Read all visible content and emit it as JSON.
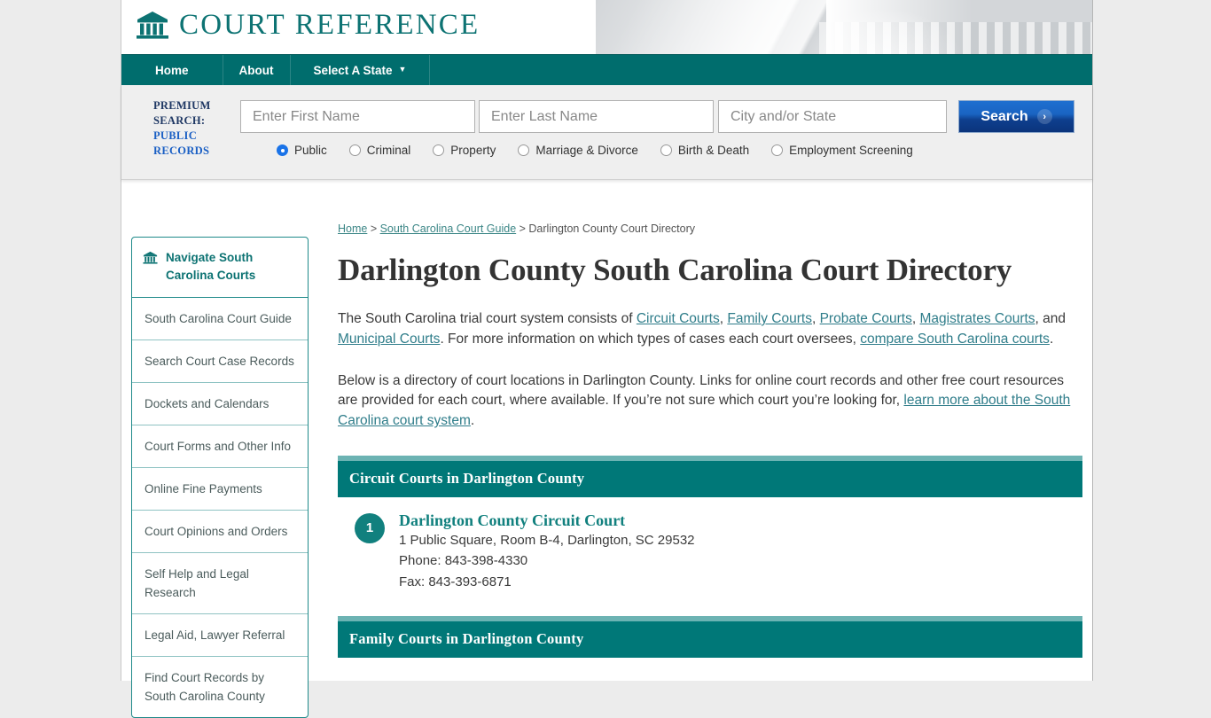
{
  "brand": {
    "title": "COURT REFERENCE",
    "logo_icon": "courthouse-icon"
  },
  "nav": {
    "items": [
      {
        "label": "Home"
      },
      {
        "label": "About"
      },
      {
        "label": "Select A State",
        "caret": "▼"
      }
    ]
  },
  "premium_search": {
    "label_line1": "PREMIUM",
    "label_line2": "SEARCH:",
    "label_line3": "PUBLIC",
    "label_line4": "RECORDS",
    "first_name_placeholder": "Enter First Name",
    "first_name_value": "",
    "last_name_placeholder": "Enter Last Name",
    "last_name_value": "",
    "city_state_placeholder": "City and/or State",
    "city_state_value": "",
    "search_button": "Search",
    "search_chevron": "›",
    "radios": [
      {
        "label": "Public",
        "selected": true
      },
      {
        "label": "Criminal",
        "selected": false
      },
      {
        "label": "Property",
        "selected": false
      },
      {
        "label": "Marriage & Divorce",
        "selected": false
      },
      {
        "label": "Birth & Death",
        "selected": false
      },
      {
        "label": "Employment Screening",
        "selected": false
      }
    ]
  },
  "sidebar": {
    "heading": "Navigate South Carolina Courts",
    "heading_icon": "courthouse-icon",
    "items": [
      {
        "label": "South Carolina Court Guide"
      },
      {
        "label": "Search Court Case Records"
      },
      {
        "label": "Dockets and Calendars"
      },
      {
        "label": "Court Forms and Other Info"
      },
      {
        "label": "Online Fine Payments"
      },
      {
        "label": "Court Opinions and Orders"
      },
      {
        "label": "Self Help and Legal Research"
      },
      {
        "label": "Legal Aid, Lawyer Referral"
      },
      {
        "label": "Find Court Records by South Carolina County"
      }
    ]
  },
  "breadcrumb": {
    "home": "Home",
    "sep": " > ",
    "guide": "South Carolina Court Guide",
    "current": "Darlington County Court Directory"
  },
  "main": {
    "title": "Darlington County South Carolina Court Directory",
    "paragraph1": {
      "t1": "The South Carolina trial court system consists of ",
      "l1": "Circuit Courts",
      "t2": ", ",
      "l2": "Family Courts",
      "t3": ", ",
      "l3": "Probate Courts",
      "t4": ", ",
      "l4": "Magistrates Courts",
      "t5": ", and ",
      "l5": "Municipal Courts",
      "t6": ". For more information on which types of cases each court oversees, ",
      "l6": "compare South Carolina courts",
      "t7": "."
    },
    "paragraph2": {
      "t1": "Below is a directory of court locations in Darlington County. Links for online court records and other free court resources are provided for each court, where available. If you’re not sure which court you’re looking for, ",
      "l1": "learn more about the South Carolina court system",
      "t2": "."
    },
    "sections": [
      {
        "heading": "Circuit Courts in Darlington County",
        "courts": [
          {
            "number": "1",
            "name": "Darlington County Circuit Court",
            "address": "1 Public Square, Room B-4, Darlington, SC 29532",
            "phone": "Phone: 843-398-4330",
            "fax": "Fax: 843-393-6871"
          }
        ]
      },
      {
        "heading": "Family Courts in Darlington County",
        "courts": []
      }
    ]
  },
  "colors": {
    "teal": "#007878",
    "teal_light": "#6cb3b3",
    "brand_teal": "#0d7373",
    "link": "#2f7d8a",
    "button_blue": "#1a64c2"
  }
}
